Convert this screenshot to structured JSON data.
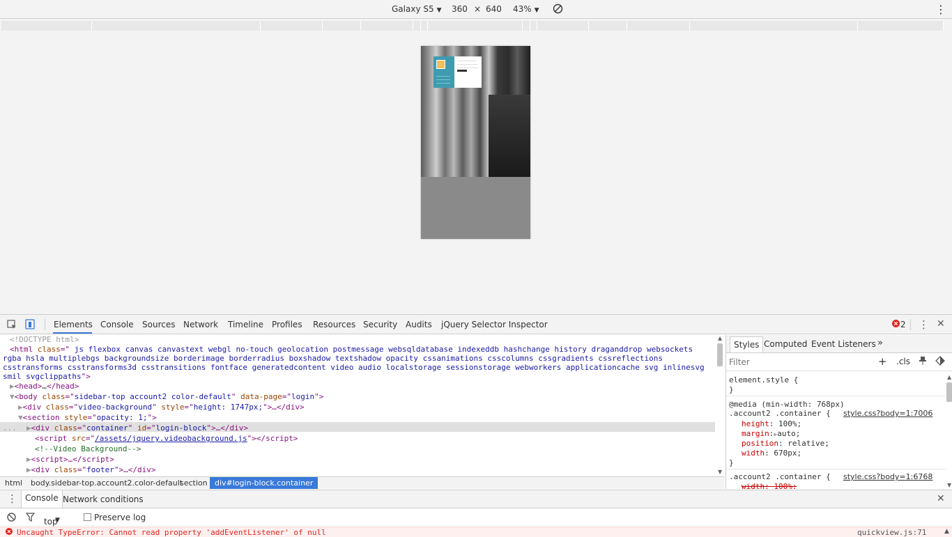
{
  "device_toolbar": {
    "device": "Galaxy S5",
    "width": "360",
    "times": "×",
    "height": "640",
    "zoom": "43%"
  },
  "devtools": {
    "tabs": [
      "Elements",
      "Console",
      "Sources",
      "Network",
      "Timeline",
      "Profiles",
      "Resources",
      "Security",
      "Audits",
      "jQuery Selector Inspector"
    ],
    "error_count": "2",
    "dom": {
      "doctype": "<!DOCTYPE html>",
      "html_line1": " js flexbox canvas canvastext webgl no-touch geolocation postmessage websqldatabase indexeddb hashchange history draganddrop websockets",
      "html_line2": "rgba hsla multiplebgs backgroundsize borderimage borderradius boxshadow textshadow opacity cssanimations csscolumns cssgradients cssreflections",
      "html_line3": "csstransforms csstransforms3d csstransitions fontface generatedcontent video audio localstorage sessionstorage webworkers applicationcache svg inlinesvg",
      "html_line4": "smil svgclippaths",
      "head": "…",
      "body_class": "sidebar-top account2 color-default",
      "body_data_page": "login",
      "video_div_class": "video-background",
      "video_div_style": "height: 1747px;",
      "section_style": "opacity: 1;",
      "container_class": "container",
      "container_id": "login-block",
      "script_src": "/assets/jquery.videobackground.js",
      "comment": "<!--Video Background-->",
      "footer_class": "footer"
    },
    "breadcrumbs": [
      "html",
      "body.sidebar-top.account2.color-default",
      "section",
      "div#login-block.container"
    ],
    "styles": {
      "tabs": [
        "Styles",
        "Computed",
        "Event Listeners"
      ],
      "filter_placeholder": "Filter",
      "cls": ".cls",
      "element_style": "element.style {",
      "close_brace": "}",
      "media": "@media (min-width: 768px)",
      "rule1_selector": ".account2 .container {",
      "rule1_source": "style.css?body=1:7006",
      "rule1_props": [
        {
          "name": "height",
          "value": "100%;"
        },
        {
          "name": "margin",
          "value": "auto;"
        },
        {
          "name": "position",
          "value": "relative;"
        },
        {
          "name": "width",
          "value": "670px;"
        }
      ],
      "rule2_selector": ".account2 .container {",
      "rule2_source": "style.css?body=1:6768",
      "rule2_prop": "width: 100%;"
    },
    "drawer": {
      "tabs": [
        "Console",
        "Network conditions"
      ],
      "context": "top",
      "preserve_log": "Preserve log",
      "error_text": "Uncaught TypeError: Cannot read property 'addEventListener' of null",
      "error_source": "quickview.js:71"
    }
  },
  "colors": {
    "accent": "#3879d9",
    "error": "#e2251e",
    "teal": "#3e9bb0"
  }
}
